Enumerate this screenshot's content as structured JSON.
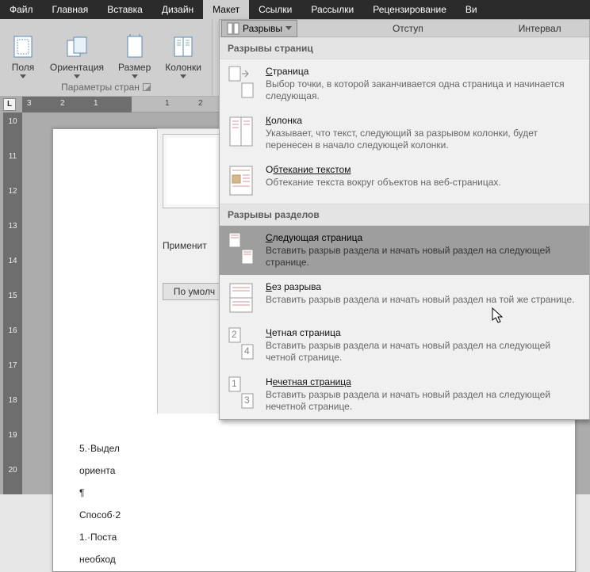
{
  "menubar": [
    "Файл",
    "Главная",
    "Вставка",
    "Дизайн",
    "Макет",
    "Ссылки",
    "Рассылки",
    "Рецензирование",
    "Ви"
  ],
  "menubar_active": 4,
  "ribbon": {
    "buttons": [
      {
        "label": "Поля",
        "icon": "margins"
      },
      {
        "label": "Ориентация",
        "icon": "orient"
      },
      {
        "label": "Размер",
        "icon": "size"
      },
      {
        "label": "Колонки",
        "icon": "columns"
      }
    ],
    "group_label": "Параметры стран",
    "breaks_label": "Разрывы",
    "indent_label": "Отступ",
    "interval_label": "Интервал"
  },
  "ruler_h": [
    "3",
    "2",
    "1",
    "1",
    "2"
  ],
  "ruler_v": [
    "10",
    "11",
    "12",
    "13",
    "14",
    "15",
    "16",
    "17",
    "18",
    "19",
    "20"
  ],
  "ruler_tab": "L",
  "pane": {
    "apply": "Применит",
    "default": "По умолч"
  },
  "doc_lines": [
    "5.·Выдел",
    "ориента",
    "¶",
    "Способ·2",
    "1.·Поста",
    "необход"
  ],
  "dropdown": {
    "top_breaks": "Разрывы",
    "indent": "Отступ",
    "interval": "Интервал",
    "section1": "Разрывы страниц",
    "items1": [
      {
        "t": "Страница",
        "u": "С",
        "d": "Выбор точки, в которой заканчивается одна страница и начинается следующая."
      },
      {
        "t": "Колонка",
        "u": "К",
        "d": "Указывает, что текст, следующий за разрывом колонки, будет перенесен в начало следующей колонки."
      },
      {
        "t": "Обтекание текстом",
        "u": "бтекание текстом",
        "pre": "О",
        "d": "Обтекание текста вокруг объектов на веб-страницах."
      }
    ],
    "section2": "Разрывы разделов",
    "items2": [
      {
        "t": "Следующая страница",
        "u": "С",
        "d": "Вставить разрыв раздела и начать новый раздел на следующей странице.",
        "hover": true
      },
      {
        "t": "Без разрыва",
        "u": "Б",
        "d": "Вставить разрыв раздела и начать новый раздел на той же странице."
      },
      {
        "t": "Четная страница",
        "u": "Ч",
        "d": "Вставить разрыв раздела и начать новый раздел на следующей четной странице."
      },
      {
        "t": "Нечетная страница",
        "u": "ечетная страница",
        "pre": "Н",
        "d": "Вставить разрыв раздела и начать новый раздел на следующей нечетной странице."
      }
    ]
  }
}
